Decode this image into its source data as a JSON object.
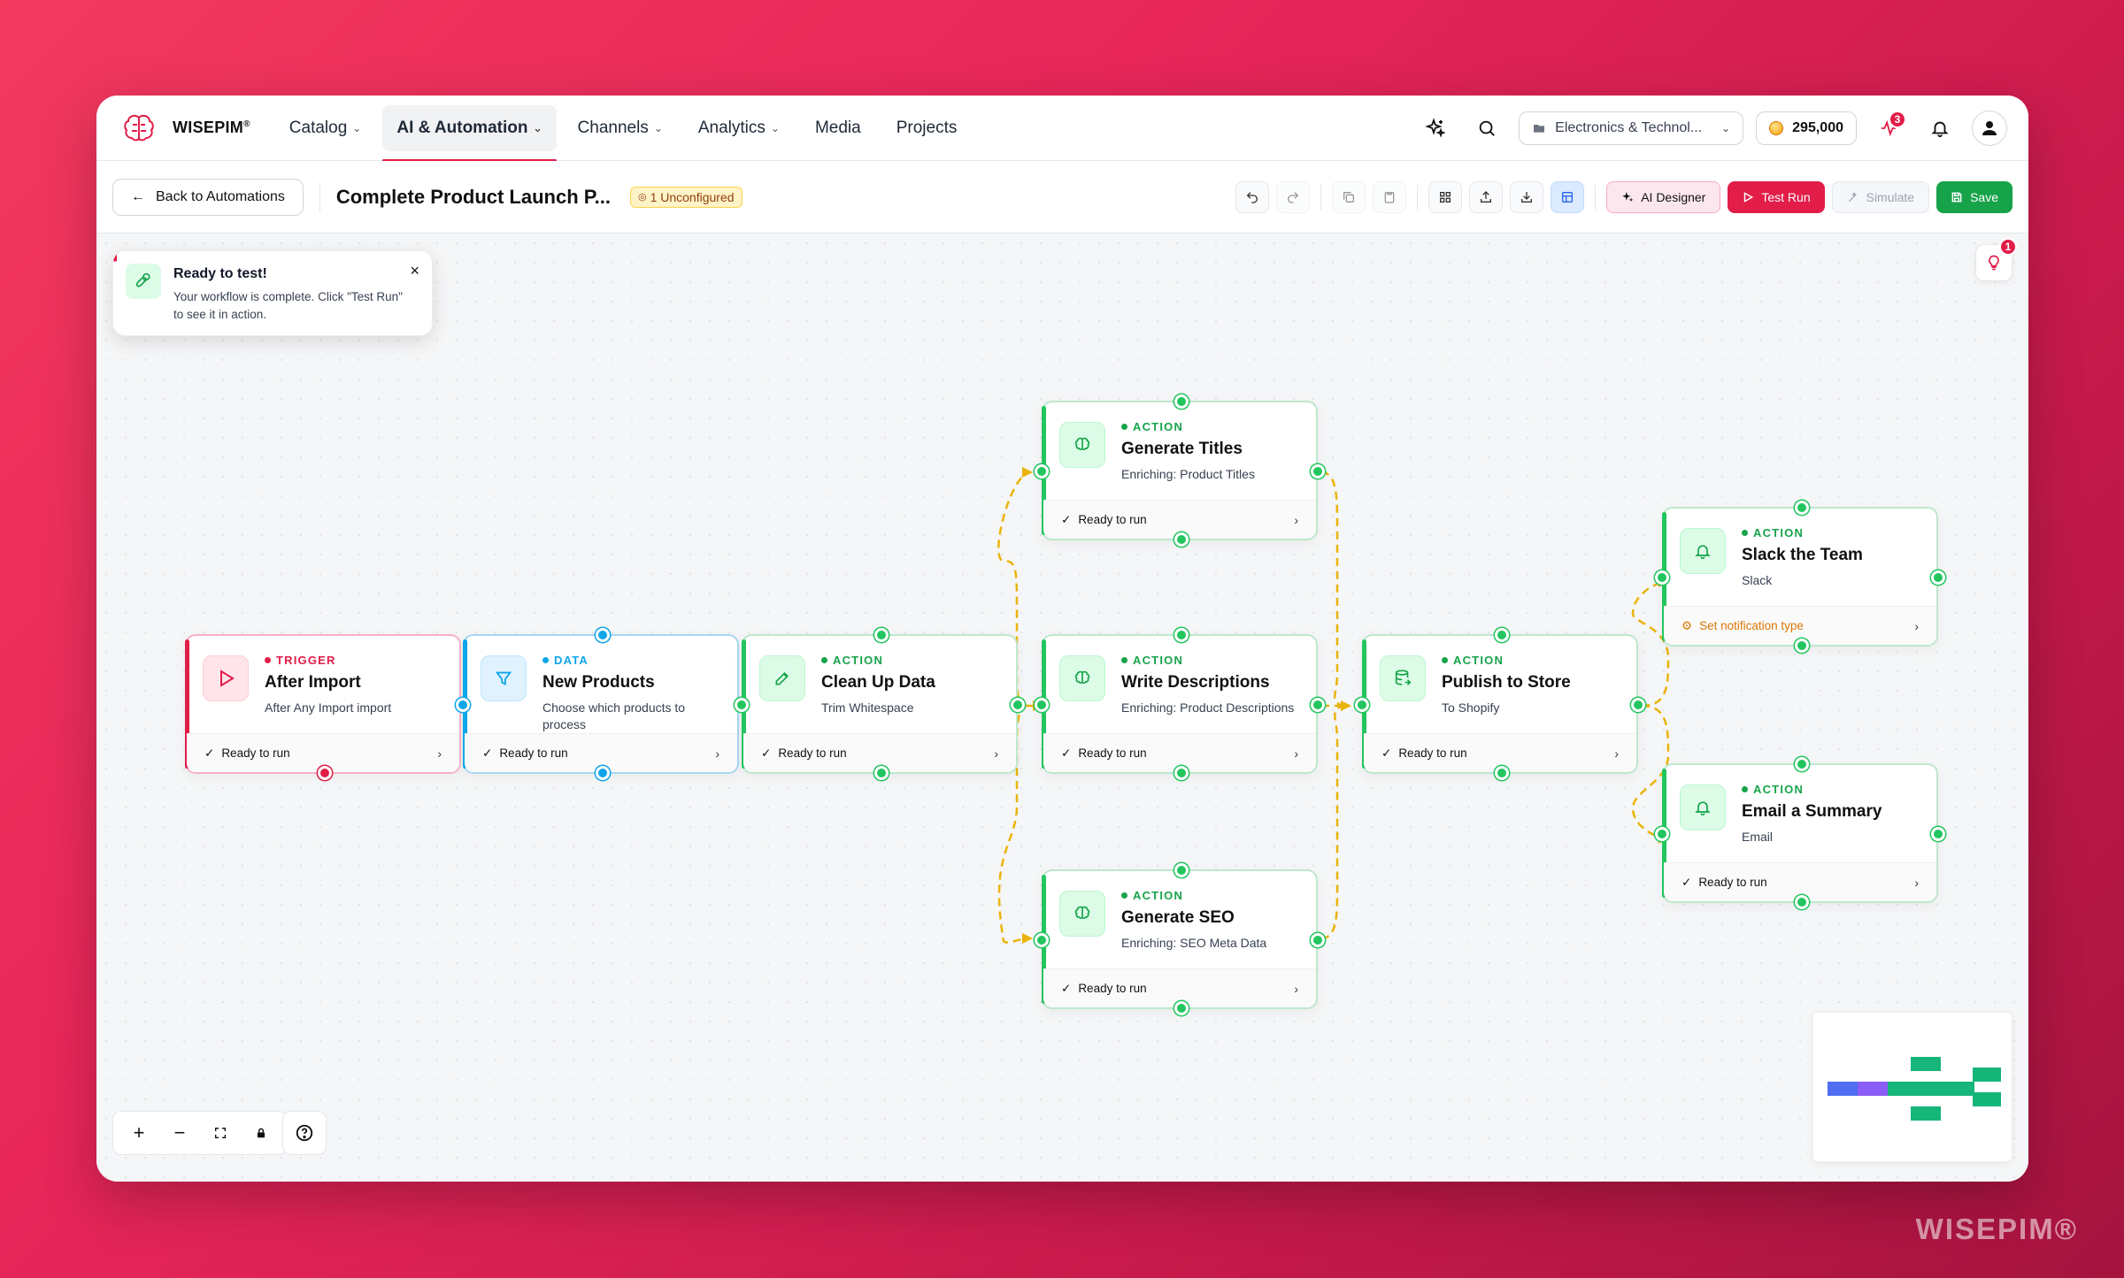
{
  "brand": {
    "name": "WISEPIM",
    "reg": "®",
    "watermark": "WISEPIM®"
  },
  "nav": {
    "items": [
      {
        "label": "Catalog",
        "dropdown": true
      },
      {
        "label": "AI & Automation",
        "dropdown": true,
        "active": true
      },
      {
        "label": "Channels",
        "dropdown": true
      },
      {
        "label": "Analytics",
        "dropdown": true
      },
      {
        "label": "Media",
        "dropdown": false
      },
      {
        "label": "Projects",
        "dropdown": false
      }
    ],
    "workspace": "Electronics & Technol...",
    "credits": "295,000",
    "activity_badge": "3",
    "icons": [
      "sparkle-icon",
      "search-icon",
      "activity-icon",
      "bell-icon",
      "user-icon"
    ]
  },
  "toolbar": {
    "back_label": "Back to Automations",
    "title": "Complete Product Launch P...",
    "unconfigured": "1 Unconfigured",
    "ai_designer": "AI Designer",
    "test_run": "Test Run",
    "simulate": "Simulate",
    "save": "Save"
  },
  "toast": {
    "title": "Ready to test!",
    "body": "Your workflow is complete. Click \"Test Run\" to see it in action."
  },
  "hint_badge": "1",
  "nodes": {
    "after_import": {
      "type": "TRIGGER",
      "title": "After Import",
      "sub": "After Any Import import",
      "status": "Ready to run"
    },
    "new_products": {
      "type": "DATA",
      "title": "New Products",
      "sub": "Choose which products to process",
      "status": "Ready to run"
    },
    "clean_up": {
      "type": "ACTION",
      "title": "Clean Up Data",
      "sub": "Trim Whitespace",
      "status": "Ready to run"
    },
    "gen_titles": {
      "type": "ACTION",
      "title": "Generate Titles",
      "sub": "Enriching: Product Titles",
      "status": "Ready to run"
    },
    "write_desc": {
      "type": "ACTION",
      "title": "Write Descriptions",
      "sub": "Enriching: Product Descriptions",
      "status": "Ready to run"
    },
    "gen_seo": {
      "type": "ACTION",
      "title": "Generate SEO",
      "sub": "Enriching: SEO Meta Data",
      "status": "Ready to run"
    },
    "publish": {
      "type": "ACTION",
      "title": "Publish to Store",
      "sub": "To Shopify",
      "status": "Ready to run"
    },
    "slack": {
      "type": "ACTION",
      "title": "Slack the Team",
      "sub": "Slack",
      "status": "Set notification type"
    },
    "email": {
      "type": "ACTION",
      "title": "Email a Summary",
      "sub": "Email",
      "status": "Ready to run"
    }
  },
  "colors": {
    "brand": "#e11d48",
    "action": "#22c55e",
    "data": "#0ea5e9",
    "edge": "#eab308",
    "save": "#16a34a"
  }
}
